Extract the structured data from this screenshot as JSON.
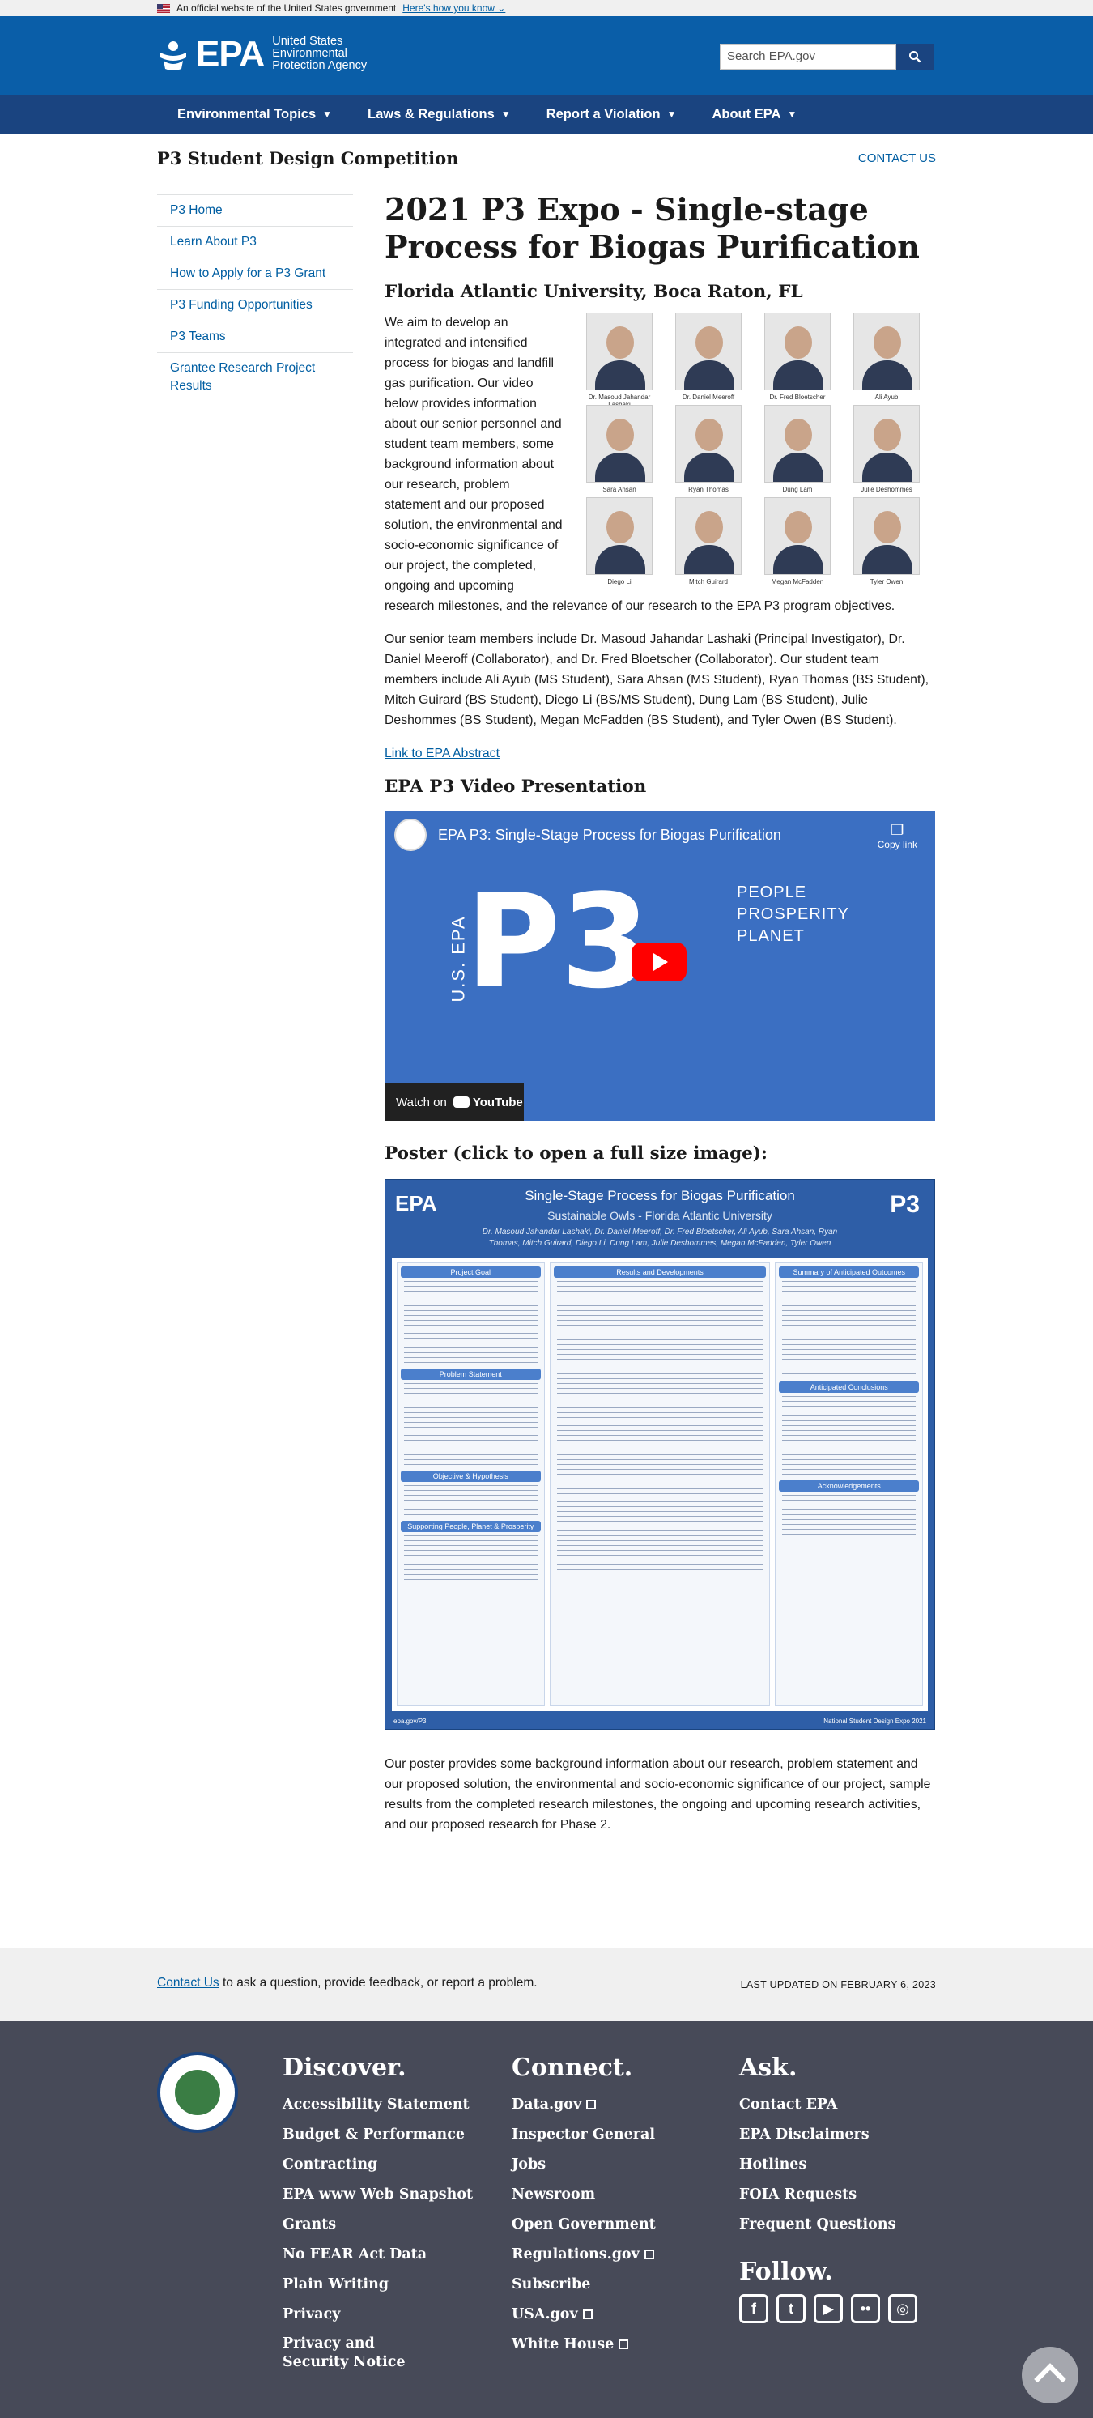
{
  "gov_banner": {
    "text": "An official website of the United States government",
    "link": "Here's how you know"
  },
  "header": {
    "logo_text": "EPA",
    "agency_name": "United States Environmental Protection Agency",
    "search_placeholder": "Search EPA.gov"
  },
  "nav": {
    "items": [
      "Environmental Topics",
      "Laws & Regulations",
      "Report a Violation",
      "About EPA"
    ]
  },
  "subheader": {
    "title": "P3 Student Design Competition",
    "contact": "CONTACT US"
  },
  "sidebar": {
    "items": [
      "P3 Home",
      "Learn About P3",
      "How to Apply for a P3 Grant",
      "P3 Funding Opportunities",
      "P3 Teams",
      "Grantee Research Project Results"
    ]
  },
  "main": {
    "title": "2021 P3 Expo - Single-stage Process for Biogas Purification",
    "subtitle": "Florida Atlantic University, Boca Raton, FL",
    "intro": "We aim to develop an integrated and intensified process for biogas and landfill gas purification. Our video below provides information about our senior personnel and student team members, some background information about our research, problem statement and our proposed solution, the environmental and socio-economic significance of our project, the completed, ongoing and upcoming research milestones, and the relevance of our research to the EPA P3 program objectives.",
    "team_paragraph": "Our senior team members include Dr. Masoud Jahandar Lashaki (Principal Investigator), Dr. Daniel Meeroff (Collaborator), and Dr. Fred Bloetscher (Collaborator). Our student team members include Ali Ayub (MS Student), Sara Ahsan (MS Student), Ryan Thomas (BS Student), Mitch Guirard (BS Student), Diego Li (BS/MS Student), Dung Lam (BS Student), Julie Deshommes (BS Student), Megan McFadden (BS Student), and Tyler Owen (BS Student).",
    "abstract_link": "Link to EPA Abstract",
    "video_heading": "EPA P3 Video Presentation",
    "poster_heading": "Poster (click to open a full size image):",
    "poster_paragraph": "Our poster provides some background information about our research, problem statement and our proposed solution, the environmental and socio-economic significance of our project, sample results from the completed research milestones, the ongoing and upcoming research activities, and our proposed research for Phase 2."
  },
  "team": [
    {
      "name": "Dr. Masoud Jahandar Lashaki"
    },
    {
      "name": "Dr. Daniel Meeroff"
    },
    {
      "name": "Dr. Fred Bloetscher"
    },
    {
      "name": "Ali Ayub"
    },
    {
      "name": "Sara Ahsan"
    },
    {
      "name": "Ryan Thomas"
    },
    {
      "name": "Dung Lam"
    },
    {
      "name": "Julie Deshommes"
    },
    {
      "name": "Diego Li"
    },
    {
      "name": "Mitch Guirard"
    },
    {
      "name": "Megan McFadden"
    },
    {
      "name": "Tyler Owen"
    }
  ],
  "video": {
    "title": "EPA P3: Single-Stage Process for Biogas Purification",
    "copy_link": "Copy link",
    "brand_vertical": "U.S. EPA",
    "brand_big": "P3",
    "tagline_1": "PEOPLE",
    "tagline_2": "PROSPERITY",
    "tagline_3": "PLANET",
    "watch_on": "Watch on",
    "youtube": "YouTube"
  },
  "poster": {
    "title": "Single-Stage Process for Biogas Purification",
    "subtitle": "Sustainable Owls - Florida Atlantic University",
    "authors": "Dr. Masoud Jahandar Lashaki, Dr. Daniel Meeroff, Dr. Fred Bloetscher, Ali Ayub, Sara Ahsan, Ryan Thomas, Mitch Guirard, Diego Li, Dung Lam, Julie Deshommes, Megan McFadden, Tyler Owen",
    "logo": "EPA",
    "p3": "P3",
    "sections_left": [
      "Project Goal",
      "Problem Statement",
      "Objective & Hypothesis",
      "Supporting People, Planet & Prosperity"
    ],
    "sections_mid": [
      "Results and Developments"
    ],
    "sections_right": [
      "Summary of Anticipated Outcomes",
      "Anticipated Conclusions",
      "Acknowledgements"
    ],
    "footer_left": "epa.gov/P3",
    "footer_right": "National Student Design Expo 2021"
  },
  "footer_band": {
    "contact_link": "Contact Us",
    "contact_text": " to ask a question, provide feedback, or report a problem.",
    "updated": "LAST UPDATED ON FEBRUARY 6, 2023"
  },
  "footer": {
    "discover": {
      "heading": "Discover.",
      "links": [
        "Accessibility Statement",
        "Budget & Performance",
        "Contracting",
        "EPA www Web Snapshot",
        "Grants",
        "No FEAR Act Data",
        "Plain Writing",
        "Privacy",
        "Privacy and Security Notice"
      ]
    },
    "connect": {
      "heading": "Connect.",
      "links": [
        "Data.gov",
        "Inspector General",
        "Jobs",
        "Newsroom",
        "Open Government",
        "Regulations.gov",
        "Subscribe",
        "USA.gov",
        "White House"
      ]
    },
    "ask": {
      "heading": "Ask.",
      "links": [
        "Contact EPA",
        "EPA Disclaimers",
        "Hotlines",
        "FOIA Requests",
        "Frequent Questions"
      ]
    },
    "follow": {
      "heading": "Follow."
    }
  }
}
